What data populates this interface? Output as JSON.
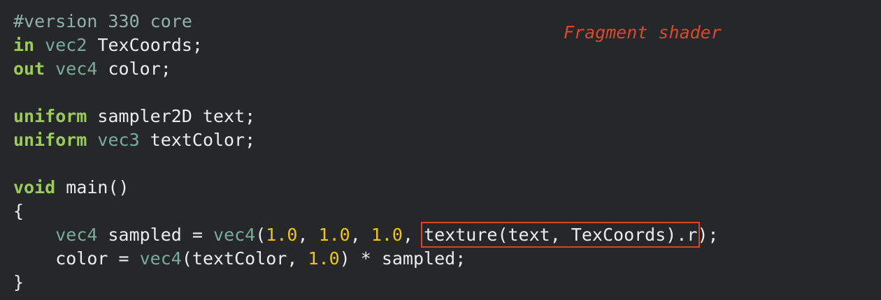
{
  "annotation": {
    "label": "Fragment shader"
  },
  "code": {
    "lines": [
      [
        {
          "text": "#version 330 core",
          "kind": "pre"
        }
      ],
      [
        {
          "text": "in",
          "kind": "kw"
        },
        {
          "text": " ",
          "kind": "plain"
        },
        {
          "text": "vec2",
          "kind": "type"
        },
        {
          "text": " TexCoords;",
          "kind": "plain"
        }
      ],
      [
        {
          "text": "out",
          "kind": "kw"
        },
        {
          "text": " ",
          "kind": "plain"
        },
        {
          "text": "vec4",
          "kind": "type"
        },
        {
          "text": " color;",
          "kind": "plain"
        }
      ],
      [],
      [
        {
          "text": "uniform",
          "kind": "kw"
        },
        {
          "text": " sampler2D text;",
          "kind": "plain"
        }
      ],
      [
        {
          "text": "uniform",
          "kind": "kw"
        },
        {
          "text": " ",
          "kind": "plain"
        },
        {
          "text": "vec3",
          "kind": "type"
        },
        {
          "text": " textColor;",
          "kind": "plain"
        }
      ],
      [],
      [
        {
          "text": "void",
          "kind": "kw"
        },
        {
          "text": " main()",
          "kind": "plain"
        }
      ],
      [
        {
          "text": "{",
          "kind": "plain"
        }
      ],
      [
        {
          "text": "    ",
          "kind": "plain"
        },
        {
          "text": "vec4",
          "kind": "type"
        },
        {
          "text": " sampled = ",
          "kind": "plain"
        },
        {
          "text": "vec4",
          "kind": "type"
        },
        {
          "text": "(",
          "kind": "plain"
        },
        {
          "text": "1.0",
          "kind": "num"
        },
        {
          "text": ", ",
          "kind": "plain"
        },
        {
          "text": "1.0",
          "kind": "num"
        },
        {
          "text": ", ",
          "kind": "plain"
        },
        {
          "text": "1.0",
          "kind": "num"
        },
        {
          "text": ", ",
          "kind": "plain"
        },
        {
          "text": "texture(text, TexCoords).r",
          "kind": "boxed"
        },
        {
          "text": ");",
          "kind": "plain"
        }
      ],
      [
        {
          "text": "    color = ",
          "kind": "plain"
        },
        {
          "text": "vec4",
          "kind": "type"
        },
        {
          "text": "(textColor, ",
          "kind": "plain"
        },
        {
          "text": "1.0",
          "kind": "num"
        },
        {
          "text": ") * sampled;",
          "kind": "plain"
        }
      ],
      [
        {
          "text": "}",
          "kind": "plain"
        }
      ]
    ]
  },
  "colors": {
    "background": "#262729",
    "keyword": "#9acb5b",
    "type": "#79ad98",
    "number": "#f0c419",
    "text": "#ececec",
    "highlight_box": "#d5462c",
    "annotation": "#e0452d"
  }
}
